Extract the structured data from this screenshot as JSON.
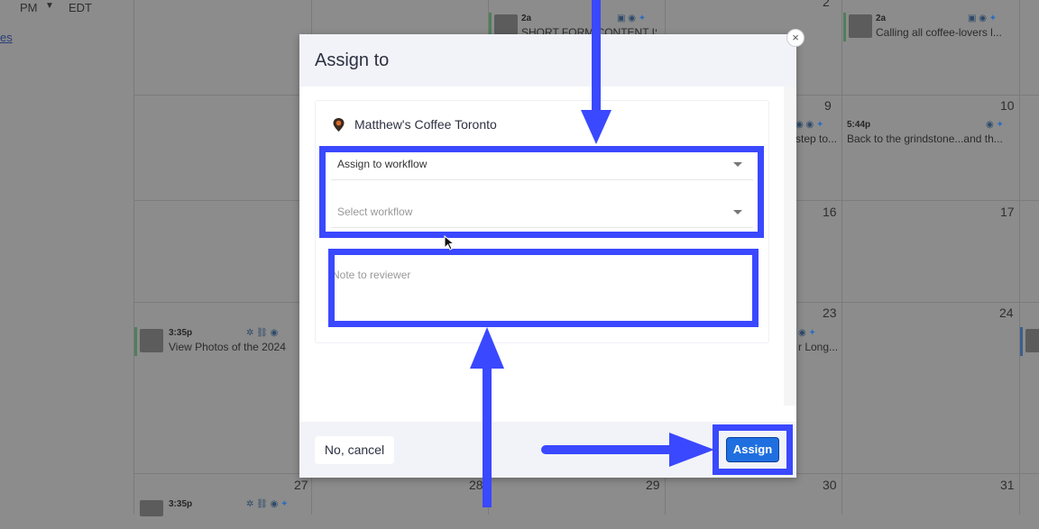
{
  "topbar": {
    "ampm": "PM",
    "timezone": "EDT",
    "side_link": "es"
  },
  "calendar": {
    "day_numbers": [
      "2",
      "9",
      "10",
      "16",
      "17",
      "23",
      "24",
      "27",
      "28",
      "29",
      "30",
      "31"
    ],
    "posts": [
      {
        "time": "2a",
        "title": "SHORT FORM CONTENT IS"
      },
      {
        "time": "2a",
        "title": "Calling all coffee-lovers l..."
      },
      {
        "time": "",
        "title": "step to..."
      },
      {
        "time": "5:44p",
        "title": "Back to the grindstone...and th..."
      },
      {
        "time": "3:35p",
        "title": "View Photos of the 2024"
      },
      {
        "time": "",
        "title": "r Long..."
      },
      {
        "time": "3:35p",
        "title": ""
      }
    ]
  },
  "modal": {
    "title": "Assign to",
    "close_glyph": "×",
    "location_name": "Matthew's Coffee Toronto",
    "assign_field_value": "Assign to workflow",
    "workflow_placeholder": "Select workflow",
    "note_placeholder": "Note to reviewer",
    "cancel_label": "No, cancel",
    "assign_label": "Assign"
  },
  "colors": {
    "annotation": "#3a48ff",
    "primary_button": "#1f6fe0",
    "twitter": "#2d6cc0"
  },
  "icons": [
    "map-pin-icon",
    "chevron-down-icon",
    "close-icon",
    "twitter-icon",
    "location-icon",
    "link-icon",
    "users-icon",
    "video-icon",
    "cursor-icon"
  ]
}
